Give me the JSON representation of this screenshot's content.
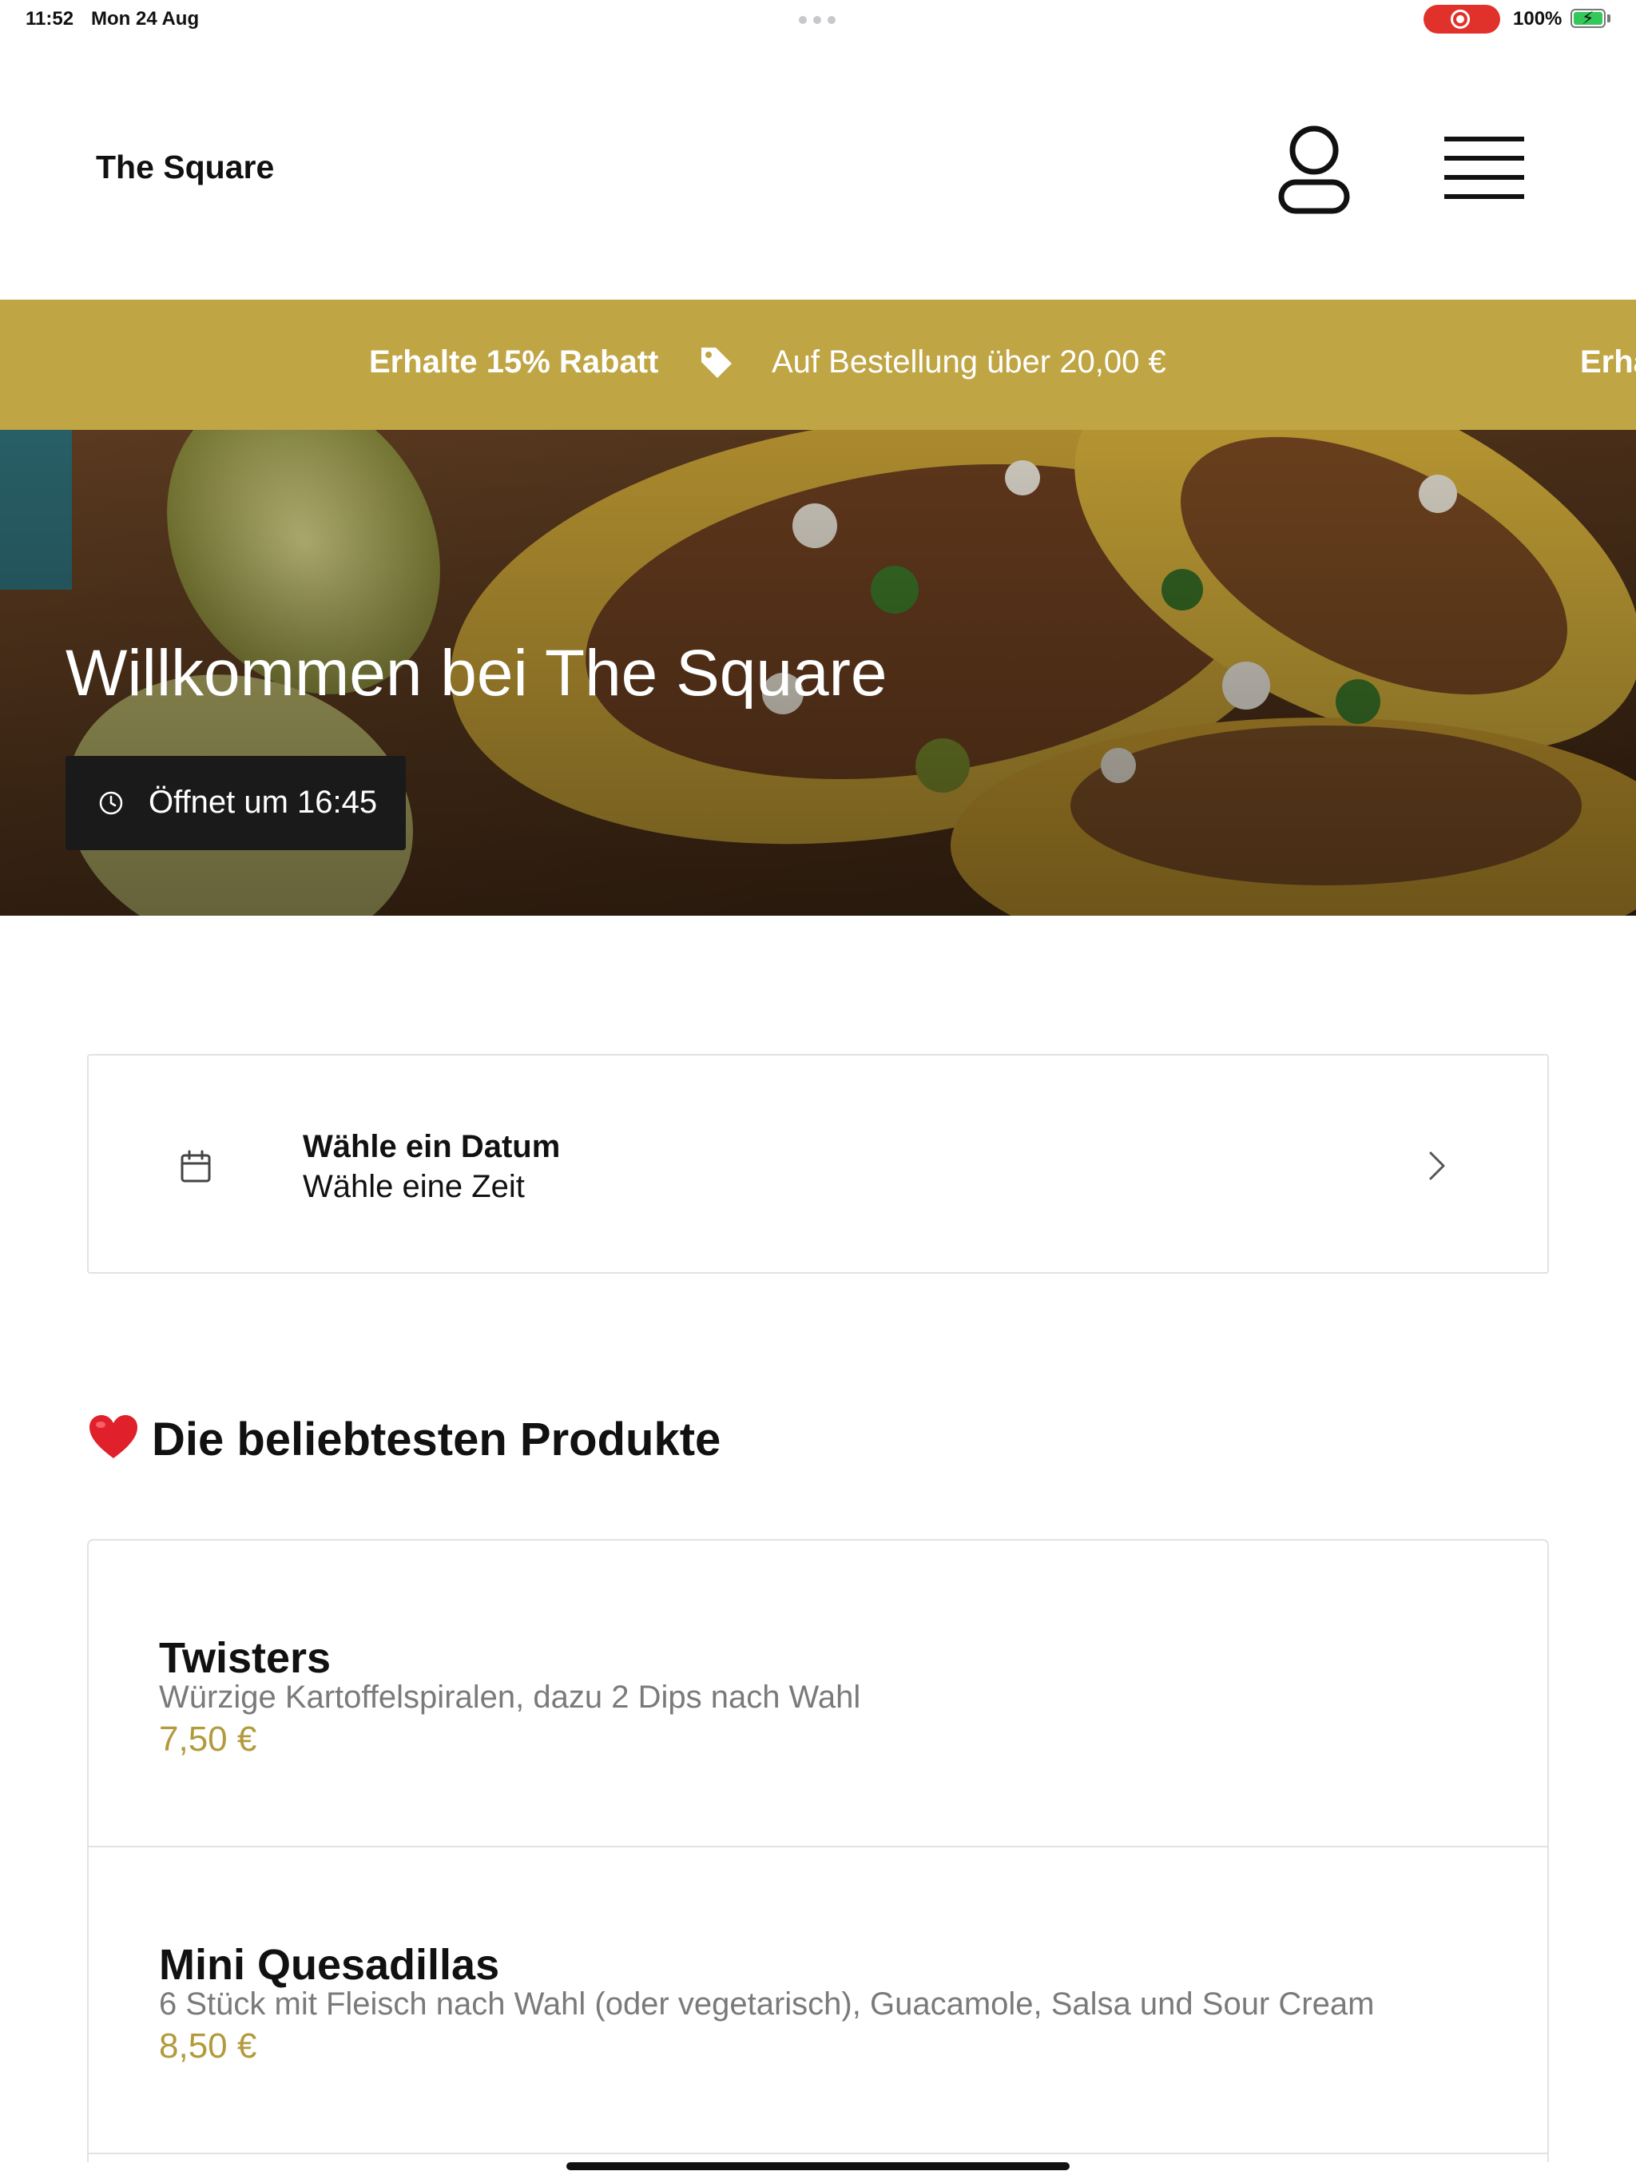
{
  "status_bar": {
    "time": "11:52",
    "date": "Mon 24 Aug",
    "battery": "100%",
    "icons": [
      "screen-recording-icon",
      "battery-charging-icon"
    ]
  },
  "header": {
    "brand": "The Square",
    "icons": [
      "user-account-icon",
      "hamburger-menu-icon"
    ]
  },
  "promo": {
    "bold": "Erhalte 15% Rabatt",
    "text": "Auf Bestellung über 20,00 €",
    "repeat_partial": "Erha",
    "icon": "price-tag-icon"
  },
  "hero": {
    "title": "Willkommen bei The Square",
    "hours": "Öffnet um 16:45",
    "icon": "clock-icon"
  },
  "date_picker": {
    "title": "Wähle ein Datum",
    "subtitle": "Wähle eine Zeit",
    "icons": [
      "calendar-icon",
      "chevron-right-icon"
    ]
  },
  "popular": {
    "title": "Die beliebtesten Produkte",
    "icon": "red-heart-icon",
    "products": [
      {
        "name": "Twisters",
        "description": "Würzige Kartoffelspiralen, dazu 2 Dips nach Wahl",
        "price": "7,50 €"
      },
      {
        "name": "Mini Quesadillas",
        "description": "6 Stück mit Fleisch nach Wahl (oder vegetarisch), Guacamole, Salsa und Sour Cream",
        "price": "8,50 €"
      }
    ]
  },
  "colors": {
    "accent_gold": "#c0a545",
    "price_gold": "#b39a3d",
    "badge_dark": "#1a1a1a",
    "record_red": "#e0322b"
  }
}
